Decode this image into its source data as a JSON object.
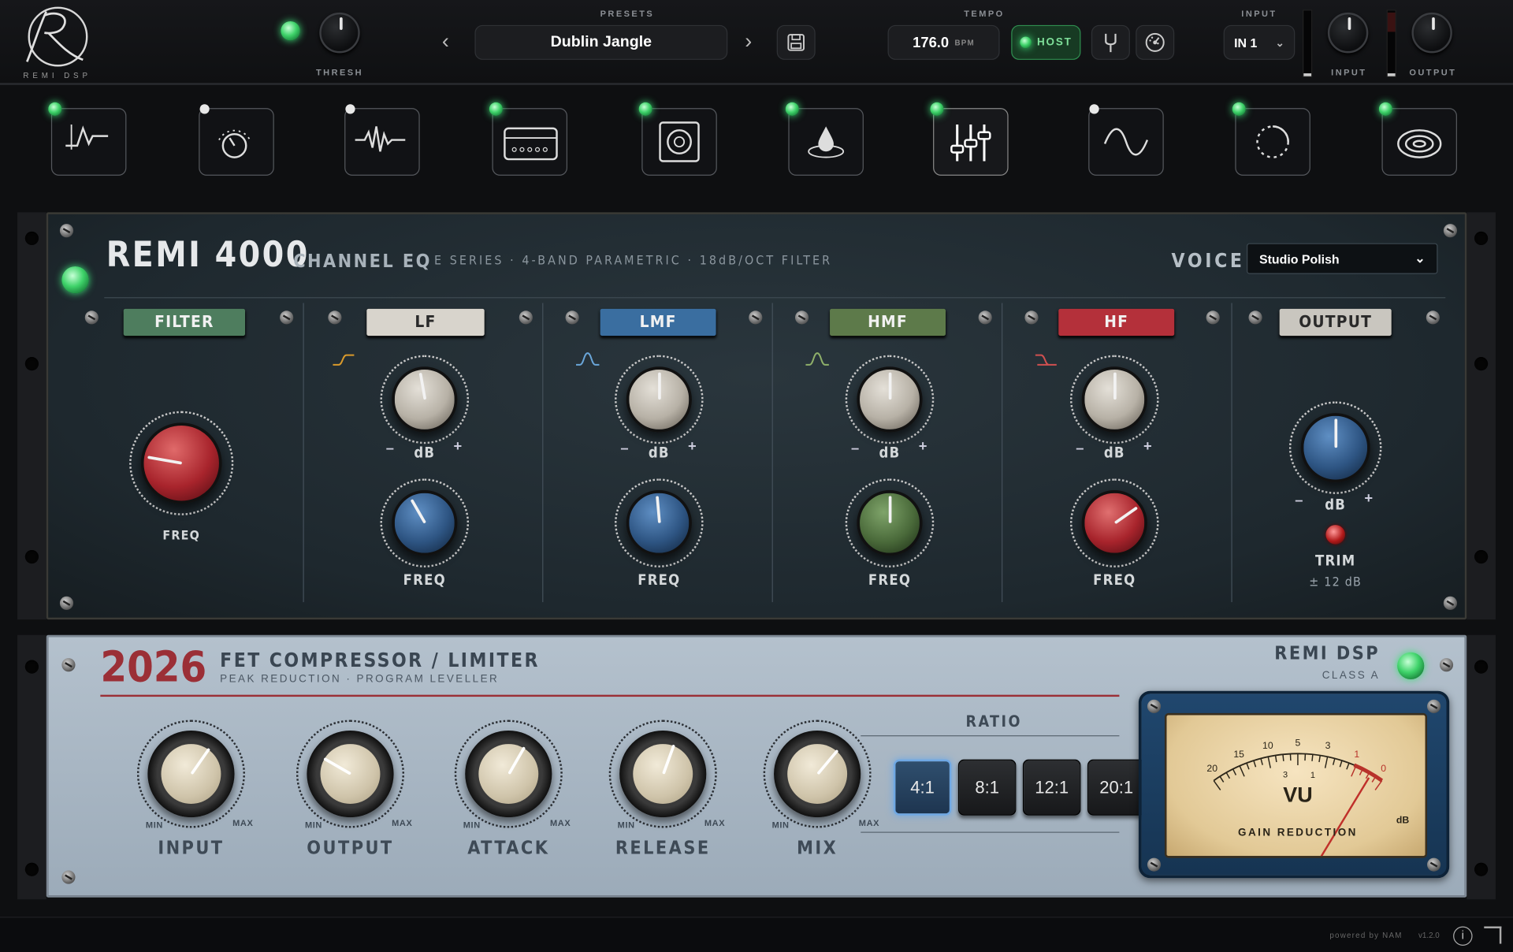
{
  "brand": {
    "logo_letter": "R",
    "name": "REMI DSP"
  },
  "header": {
    "thresh_label": "THRESH",
    "presets_label": "PRESETS",
    "preset_name": "Dublin Jangle",
    "tempo_label": "TEMPO",
    "tempo_value": "176.0",
    "tempo_unit": "BPM",
    "host_label": "HOST",
    "input_section_label": "INPUT",
    "input_select": "IN 1",
    "input_knob_label": "INPUT",
    "output_knob_label": "OUTPUT"
  },
  "modules": [
    {
      "icon": "noise-gate-icon",
      "led": "on"
    },
    {
      "icon": "drive-knob-icon",
      "led": "off"
    },
    {
      "icon": "waveform-icon",
      "led": "off"
    },
    {
      "icon": "amp-icon",
      "led": "on"
    },
    {
      "icon": "cabinet-icon",
      "led": "on"
    },
    {
      "icon": "drop-icon",
      "led": "on"
    },
    {
      "icon": "eq-sliders-icon",
      "led": "on"
    },
    {
      "icon": "modulation-wave-icon",
      "led": "off"
    },
    {
      "icon": "delay-icon",
      "led": "on"
    },
    {
      "icon": "reverb-icon",
      "led": "on"
    }
  ],
  "eq": {
    "model": "REMI 4000",
    "subtitle": "CHANNEL EQ",
    "tagline": "E SERIES · 4-BAND PARAMETRIC · 18dB/OCT FILTER",
    "voice_label": "VOICE",
    "voice_value": "Studio Polish",
    "bands": {
      "filter": {
        "title": "FILTER",
        "freq": "FREQ"
      },
      "lf": {
        "title": "LF",
        "db": "dB",
        "freq": "FREQ"
      },
      "lmf": {
        "title": "LMF",
        "db": "dB",
        "freq": "FREQ"
      },
      "hmf": {
        "title": "HMF",
        "db": "dB",
        "freq": "FREQ"
      },
      "hf": {
        "title": "HF",
        "db": "dB",
        "freq": "FREQ"
      },
      "output": {
        "title": "OUTPUT",
        "db": "dB",
        "trim": "TRIM",
        "trim_range": "± 12 dB"
      }
    },
    "minus": "–",
    "plus": "+"
  },
  "comp": {
    "model": "2026",
    "title": "FET COMPRESSOR / LIMITER",
    "subtitle": "PEAK REDUCTION · PROGRAM LEVELLER",
    "brand": "REMI DSP",
    "class": "CLASS A",
    "knobs": [
      "INPUT",
      "OUTPUT",
      "ATTACK",
      "RELEASE",
      "MIX"
    ],
    "min": "MIN",
    "max": "MAX",
    "ratio_label": "RATIO",
    "ratios": [
      "4:1",
      "8:1",
      "12:1",
      "20:1"
    ],
    "selected_ratio": "4:1",
    "vu": {
      "title": "VU",
      "caption": "GAIN REDUCTION",
      "unit": "dB",
      "scale": [
        "20",
        "15",
        "10",
        "5",
        "3",
        "1",
        "0"
      ],
      "inner": [
        "3",
        "1"
      ],
      "reading_db": "0"
    }
  },
  "footer": {
    "powered": "powered by NAM",
    "version": "v1.2.0"
  },
  "colors": {
    "green_led": "#3fd36a",
    "lf": "#d8d4cc",
    "lmf": "#3a6ea0",
    "hmf": "#5d7a4a",
    "hf": "#b4303a",
    "filter": "#4e7d5e",
    "output": "#c9c6bf",
    "accent_red": "#9b2f36"
  }
}
